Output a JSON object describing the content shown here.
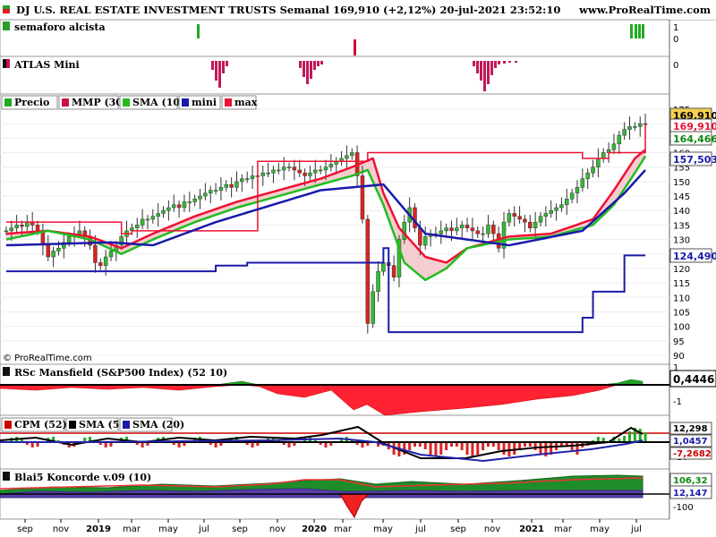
{
  "header": {
    "title": "DJ U.S. REAL ESTATE INVESTMENT TRUSTS Semanal 169,910 (+2,12%) 20-jul-2021 23:52:10",
    "site": "www.ProRealTime.com",
    "watermark": "© ProRealTime.com"
  },
  "panels": {
    "semaforo": {
      "label": "semaforo alcista",
      "scale_top": "1",
      "scale_bottom": "0",
      "color": "#22aa22"
    },
    "atlas": {
      "label": "ATLAS Mini",
      "scale_top": "0",
      "color": "#c0195a"
    },
    "price": {
      "legend": [
        {
          "label": "Precio",
          "color": "#22aa22"
        },
        {
          "label": "MMP (30)",
          "color": "#cc1144"
        },
        {
          "label": "SMA (10)",
          "color": "#22bb22"
        },
        {
          "label": "mini",
          "color": "#1a1aaa"
        },
        {
          "label": "max",
          "color": "#ee1133"
        }
      ],
      "value_tags": [
        {
          "text": "169,910",
          "bg": "#f5d04a",
          "fg": "#000000"
        },
        {
          "text": "169,910",
          "bg": "#ffffff",
          "fg": "#ee1133"
        },
        {
          "text": "164,466",
          "bg": "#ffffff",
          "fg": "#118811"
        },
        {
          "text": "157,503",
          "bg": "#ffffff",
          "fg": "#1a1aaa"
        },
        {
          "text": "124,490",
          "bg": "#ffffff",
          "fg": "#1a1aaa"
        }
      ]
    },
    "rsc": {
      "label": "RSc Mansfield (S&P500 Index) (52 10)",
      "value": "0,4446",
      "ticks": [
        "1",
        "-1"
      ]
    },
    "cpm": {
      "legend": [
        {
          "label": "CPM (52)",
          "color": "#cc0000"
        },
        {
          "label": "SMA (5)",
          "color": "#000000"
        },
        {
          "label": "SMA (20)",
          "color": "#1a1aaa"
        }
      ],
      "value_tags": [
        {
          "text": "12,298",
          "color": "#000000"
        },
        {
          "text": "1,0457",
          "color": "#1a1aaa"
        },
        {
          "text": "-7,2682",
          "color": "#cc0000"
        }
      ],
      "ticks": [
        "12,298",
        "-10"
      ]
    },
    "koncorde": {
      "label": "Blai5 Koncorde v.09 (10)",
      "value_tags": [
        {
          "text": "106,32",
          "color": "#118811"
        },
        {
          "text": "12,147",
          "color": "#1a1aaa"
        }
      ],
      "ticks": [
        "-100"
      ]
    }
  },
  "chart_data": {
    "type": "candlestick",
    "title": "DJ U.S. REAL ESTATE INVESTMENT TRUSTS Semanal",
    "x_labels": [
      "sep",
      "nov",
      "2019",
      "mar",
      "may",
      "jul",
      "sep",
      "nov",
      "2020",
      "mar",
      "may",
      "jul",
      "sep",
      "nov",
      "2021",
      "mar",
      "may",
      "jul"
    ],
    "y_ticks": [
      175,
      170,
      165,
      160,
      155,
      150,
      145,
      140,
      135,
      130,
      125,
      120,
      115,
      110,
      105,
      100,
      95,
      90
    ],
    "ylim": [
      88,
      178
    ],
    "last_close": 169.91,
    "change_pct": 2.12,
    "date": "20-jul-2021",
    "series": [
      {
        "name": "Precio",
        "type": "candlestick",
        "values": [
          133,
          134,
          135,
          134.5,
          136,
          135,
          133,
          128,
          124,
          126,
          127,
          129,
          131,
          132,
          133,
          131,
          128,
          122,
          121,
          124,
          126,
          128,
          131,
          133,
          134,
          135,
          137,
          137,
          138,
          139,
          140,
          141,
          142,
          141,
          143,
          143,
          144,
          145,
          146,
          147,
          147,
          148,
          149,
          148,
          150,
          151,
          151,
          152,
          152,
          153,
          153,
          154,
          154,
          155,
          155,
          154,
          153,
          152,
          153,
          154,
          154,
          155,
          156,
          157,
          158,
          159,
          160,
          152,
          137,
          101,
          112,
          119,
          122,
          121,
          117,
          130,
          136,
          141,
          134,
          128,
          131,
          132,
          132,
          133,
          134,
          133,
          134,
          135,
          134,
          133,
          132,
          132,
          135,
          132,
          127,
          136,
          139,
          138,
          137,
          136,
          134,
          136,
          138,
          139,
          140,
          141,
          142,
          144,
          146,
          148,
          151,
          153,
          155,
          158,
          160,
          161,
          163,
          166,
          168,
          169,
          169,
          170,
          169.9
        ]
      },
      {
        "name": "MMP (30)",
        "type": "line",
        "color": "#ee1133",
        "values": [
          [
            0,
            132
          ],
          [
            8,
            133
          ],
          [
            16,
            131
          ],
          [
            22,
            127
          ],
          [
            28,
            132
          ],
          [
            36,
            138
          ],
          [
            44,
            143
          ],
          [
            52,
            147
          ],
          [
            60,
            151
          ],
          [
            66,
            155
          ],
          [
            70,
            158
          ],
          [
            72,
            146
          ],
          [
            75,
            134
          ],
          [
            80,
            124
          ],
          [
            84,
            122
          ],
          [
            88,
            127
          ],
          [
            96,
            131
          ],
          [
            104,
            132
          ],
          [
            112,
            137
          ],
          [
            116,
            147
          ],
          [
            120,
            158
          ],
          [
            124,
            164
          ]
        ]
      },
      {
        "name": "SMA (10)",
        "type": "line",
        "color": "#22bb22",
        "values": [
          [
            0,
            130
          ],
          [
            8,
            133
          ],
          [
            16,
            130
          ],
          [
            22,
            125
          ],
          [
            28,
            130
          ],
          [
            36,
            136
          ],
          [
            44,
            141
          ],
          [
            52,
            145
          ],
          [
            60,
            149
          ],
          [
            66,
            152
          ],
          [
            69,
            154
          ],
          [
            72,
            142
          ],
          [
            76,
            122
          ],
          [
            80,
            116
          ],
          [
            84,
            120
          ],
          [
            88,
            127
          ],
          [
            96,
            130
          ],
          [
            104,
            131
          ],
          [
            112,
            135
          ],
          [
            116,
            142
          ],
          [
            120,
            153
          ],
          [
            124,
            164.5
          ]
        ]
      },
      {
        "name": "mini",
        "type": "step",
        "color": "#1a1aaa",
        "values": [
          [
            0,
            119
          ],
          [
            38,
            119
          ],
          [
            40,
            121
          ],
          [
            42,
            121
          ],
          [
            46,
            122
          ],
          [
            70,
            122
          ],
          [
            72,
            127
          ],
          [
            73,
            98
          ],
          [
            105,
            98
          ],
          [
            109,
            98
          ],
          [
            110,
            103
          ],
          [
            112,
            112
          ],
          [
            117,
            112
          ],
          [
            118,
            124.5
          ],
          [
            124,
            124.5
          ]
        ]
      },
      {
        "name": "max",
        "type": "step",
        "color": "#ee1133",
        "values": [
          [
            0,
            136
          ],
          [
            20,
            136
          ],
          [
            21,
            136
          ],
          [
            22,
            132
          ],
          [
            24,
            133
          ],
          [
            48,
            157
          ],
          [
            69,
            160
          ],
          [
            104,
            160
          ],
          [
            106,
            160
          ],
          [
            110,
            158
          ],
          [
            115,
            160
          ],
          [
            124,
            169.9
          ]
        ]
      }
    ]
  }
}
